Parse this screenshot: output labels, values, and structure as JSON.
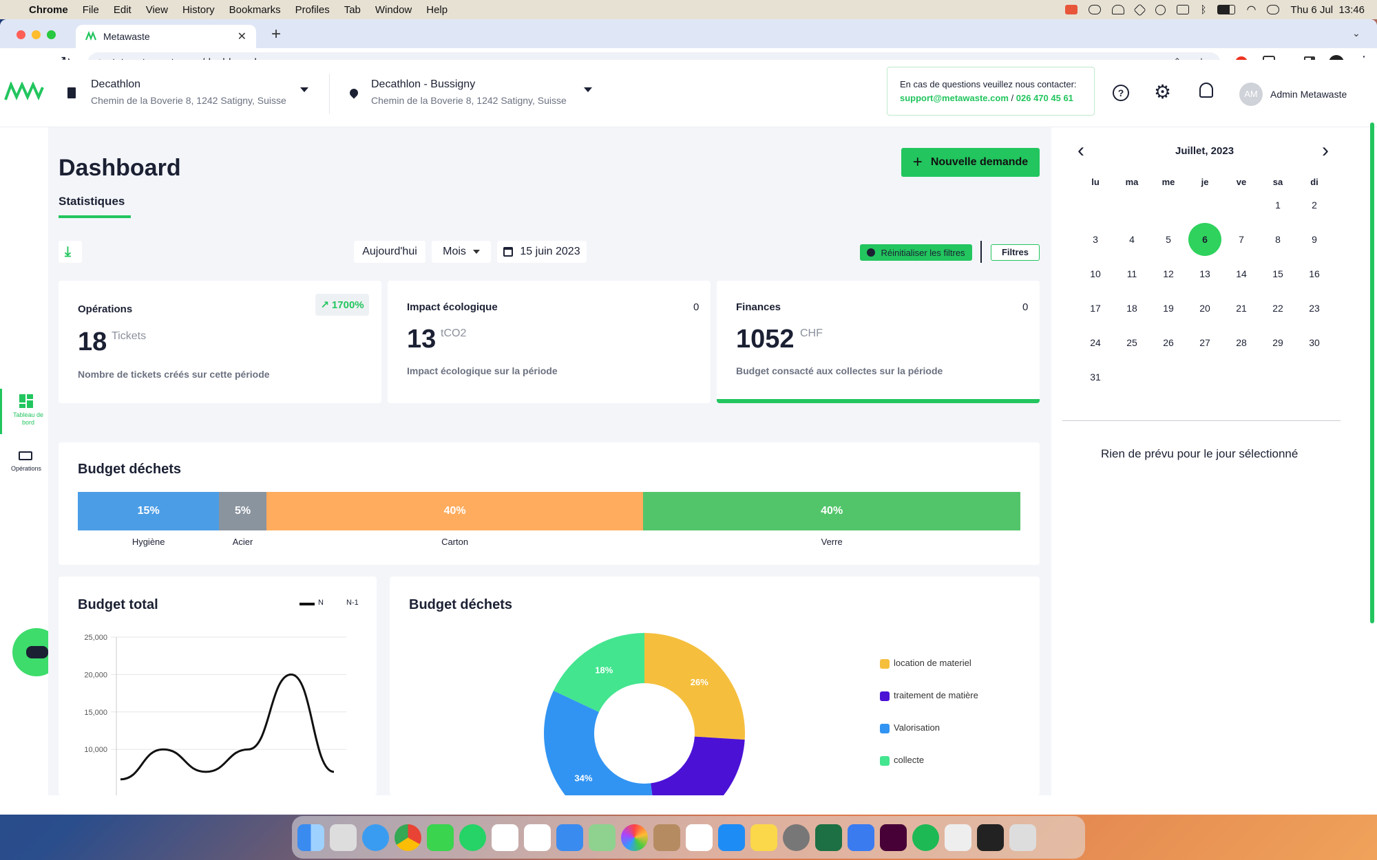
{
  "menubar": {
    "app": "Chrome",
    "items": [
      "File",
      "Edit",
      "View",
      "History",
      "Bookmarks",
      "Profiles",
      "Tab",
      "Window",
      "Help"
    ],
    "clock": "Thu 6 Jul  13:46"
  },
  "browser": {
    "tab_title": "Metawaste",
    "url": "tst.metawaste.app/dashboard"
  },
  "header": {
    "company": {
      "name": "Decathlon",
      "address": "Chemin de la Boverie 8, 1242 Satigny, Suisse"
    },
    "site": {
      "name": "Decathlon - Bussigny",
      "address": "Chemin de la Boverie 8, 1242 Satigny, Suisse"
    },
    "contact": {
      "text": "En cas de questions veuillez nous contacter:",
      "email": "support@metawaste.com",
      "sep": "/",
      "phone": "026 470 45 61"
    },
    "user": {
      "initials": "AM",
      "name": "Admin Metawaste"
    }
  },
  "sidebar": {
    "items": [
      {
        "label": "Tableau de bord",
        "icon": "dashboard-icon"
      },
      {
        "label": "Opérations",
        "icon": "truck-icon"
      }
    ]
  },
  "page": {
    "title": "Dashboard",
    "tab": "Statistiques",
    "new_request": "Nouvelle demande"
  },
  "filters": {
    "today": "Aujourd'hui",
    "period": "Mois",
    "date": "15 juin 2023",
    "reset": "Réinitialiser les filtres",
    "filters": "Filtres"
  },
  "stats": [
    {
      "title": "Opérations",
      "badge": "1700%",
      "value": "18",
      "unit": "Tickets",
      "desc": "Nombre de tickets créés sur cette période"
    },
    {
      "title": "Impact écologique",
      "badge": "0",
      "value": "13",
      "unit": "tCO2",
      "desc": "Impact écologique sur la période"
    },
    {
      "title": "Finances",
      "badge": "0",
      "value": "1052",
      "unit": "CHF",
      "desc": "Budget consacté aux collectes sur la période"
    }
  ],
  "budget_dechets_bar": {
    "title": "Budget déchets"
  },
  "budget_total": {
    "title": "Budget total",
    "legend_n": "N",
    "legend_n1": "N-1"
  },
  "budget_dechets_donut": {
    "title": "Budget déchets"
  },
  "calendar": {
    "month": "Juillet, 2023",
    "dows": [
      "lu",
      "ma",
      "me",
      "je",
      "ve",
      "sa",
      "di"
    ],
    "selected": "6",
    "empty": "Rien de prévu pour le jour sélectionné"
  },
  "chart_data": [
    {
      "type": "bar",
      "title": "Budget déchets",
      "categories": [
        "Hygiène",
        "Acier",
        "Carton",
        "Verre"
      ],
      "values": [
        15,
        5,
        40,
        40
      ],
      "labels": [
        "15%",
        "5%",
        "40%",
        "40%"
      ],
      "colors": [
        "#4b9de6",
        "#8a949f",
        "#ffac5e",
        "#52c56a"
      ]
    },
    {
      "type": "line",
      "title": "Budget total",
      "series": [
        {
          "name": "N",
          "values": [
            {
              "x": 0,
              "y": 6000
            },
            {
              "x": 1,
              "y": 10000
            },
            {
              "x": 2,
              "y": 7000
            },
            {
              "x": 3,
              "y": 10000
            },
            {
              "x": 4,
              "y": 20000
            },
            {
              "x": 5,
              "y": 7000
            }
          ]
        }
      ],
      "yticks": [
        "10,000",
        "15,000",
        "20,000",
        "25,000"
      ],
      "ylim": [
        0,
        25000
      ]
    },
    {
      "type": "pie",
      "title": "Budget déchets",
      "slices": [
        {
          "label": "location de materiel",
          "value": 26,
          "text": "26%",
          "color": "#f5bf3d"
        },
        {
          "label": "traitement de matière",
          "value": 22,
          "text": "",
          "color": "#4b12d6"
        },
        {
          "label": "Valorisation",
          "value": 34,
          "text": "34%",
          "color": "#3294f2"
        },
        {
          "label": "collecte",
          "value": 18,
          "text": "18%",
          "color": "#43e58f"
        }
      ]
    }
  ]
}
